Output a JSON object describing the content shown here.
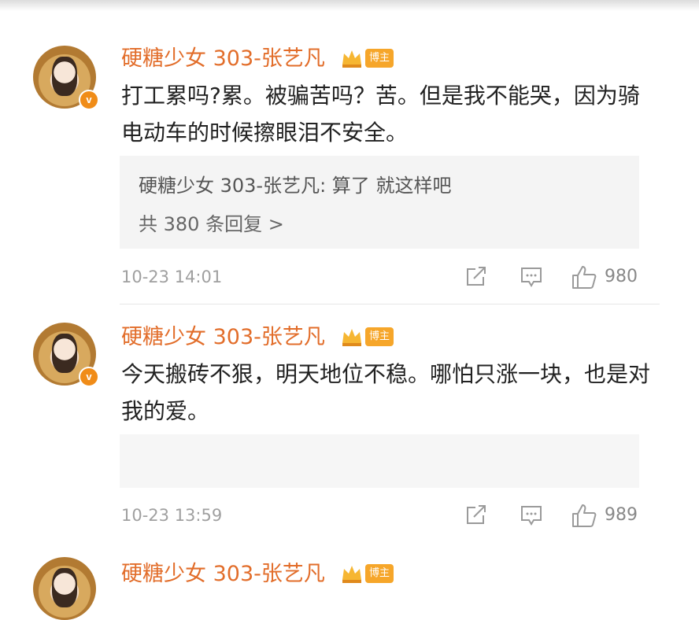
{
  "comments": [
    {
      "username": "硬糖少女 303-张艺凡",
      "avatar_badge": "v",
      "author_tag": "博主",
      "text": "打工累吗?累。被骗苦吗？苦。但是我不能哭，因为骑电动车的时候擦眼泪不安全。",
      "reply_preview": "硬糖少女 303-张艺凡: 算了 就这样吧",
      "reply_count_label": "共 380 条回复 >",
      "timestamp": "10-23 14:01",
      "likes": "980"
    },
    {
      "username": "硬糖少女 303-张艺凡",
      "avatar_badge": "v",
      "author_tag": "博主",
      "text": "今天搬砖不狠，明天地位不稳。哪怕只涨一块，也是对我的爱。",
      "timestamp": "10-23 13:59",
      "likes": "989"
    },
    {
      "username": "硬糖少女 303-张艺凡",
      "author_tag": "博主"
    }
  ],
  "colors": {
    "username": "#e26d2a",
    "author_tag_bg": "#f6a62a",
    "vip_badge": "#f08c18"
  },
  "icons": [
    "crown-icon",
    "verified-badge-icon",
    "share-icon",
    "comment-icon",
    "like-icon"
  ]
}
